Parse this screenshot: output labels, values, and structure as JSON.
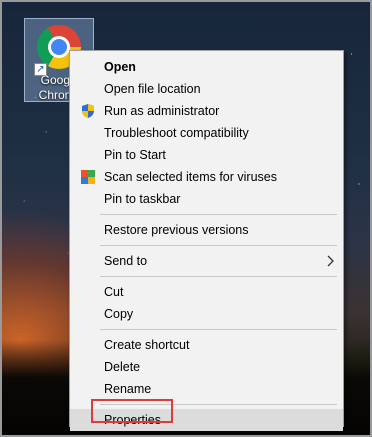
{
  "desktop_icon": {
    "label": "Google\nChrome",
    "icon": "chrome-icon",
    "overlay_icon": "shortcut-arrow-icon"
  },
  "context_menu": {
    "items": [
      {
        "label": "Open",
        "bold": true
      },
      {
        "label": "Open file location"
      },
      {
        "label": "Run as administrator",
        "icon": "uac-shield-icon"
      },
      {
        "label": "Troubleshoot compatibility"
      },
      {
        "label": "Pin to Start"
      },
      {
        "label": "Scan selected items for viruses",
        "icon": "antivirus-icon"
      },
      {
        "label": "Pin to taskbar"
      },
      {
        "label": "Restore previous versions"
      },
      {
        "label": "Send to",
        "submenu": true
      },
      {
        "label": "Cut"
      },
      {
        "label": "Copy"
      },
      {
        "label": "Create shortcut"
      },
      {
        "label": "Delete"
      },
      {
        "label": "Rename"
      },
      {
        "label": "Properties",
        "highlighted": true,
        "annotated": true
      }
    ]
  },
  "colors": {
    "menu_background": "#f2f2f2",
    "highlight": "#dcdcdc",
    "annotation_box": "#e03a3a"
  }
}
